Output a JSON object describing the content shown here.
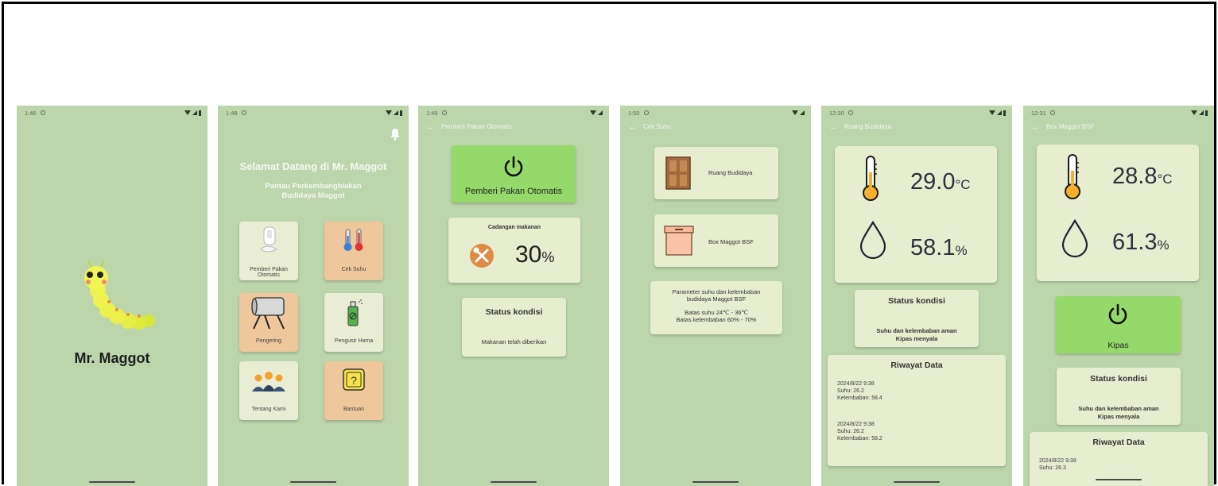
{
  "splash": {
    "time": "1:46",
    "title": "Mr. Maggot"
  },
  "home": {
    "time": "1:48",
    "welcome": "Selamat Datang di Mr. Maggot",
    "subtitle_line1": "Pantau Perkembangbiakan",
    "subtitle_line2": "Budidaya Maggot",
    "tiles": [
      {
        "label_line1": "Pemberi Pakan",
        "label_line2": "Otomatis"
      },
      {
        "label_line1": "Cek Suhu",
        "label_line2": ""
      },
      {
        "label_line1": "Pengering",
        "label_line2": ""
      },
      {
        "label_line1": "Pengusir Hama",
        "label_line2": ""
      },
      {
        "label_line1": "Tentang Kami",
        "label_line2": ""
      },
      {
        "label_line1": "Bantuan",
        "label_line2": ""
      }
    ]
  },
  "feeder": {
    "time": "1:49",
    "title": "Pemberi Pakan Otomatis",
    "button_label": "Pemberi Pakan Otomatis",
    "reserve_label": "Cadangan makanan",
    "reserve_value": "30",
    "reserve_unit": "%",
    "reserve_level": 0.3,
    "status_title": "Status kondisi",
    "status_text": "Makanan telah diberikan"
  },
  "temp_check": {
    "time": "1:50",
    "title": "Cek Suhu",
    "option1": "Ruang Budidaya",
    "option2": "Box Maggot BSF",
    "info_line1": "Parameter suhu dan kelembaban",
    "info_line2": "budidaya Maggot BSF",
    "info_line3": "Batas suhu 24℃ - 36℃",
    "info_line4": "Batas kelembaban 60% - 70%"
  },
  "ruang": {
    "time": "12:30",
    "title": "Ruang Budidaya",
    "temp_value": "29.0",
    "temp_unit": "°C",
    "hum_value": "58.1",
    "hum_unit": "%",
    "status_title": "Status kondisi",
    "status_line1": "Suhu dan kelembaban aman",
    "status_line2": "Kipas menyala",
    "history_title": "Riwayat Data",
    "history": [
      {
        "date": "2024/8/22 9:38",
        "suhu": "Suhu: 26.2",
        "lembab": "Kelembaban: 58.4"
      },
      {
        "date": "2024/8/22 9:38",
        "suhu": "Suhu: 26.2",
        "lembab": "Kelembaban: 58.2"
      }
    ]
  },
  "box": {
    "time": "12:31",
    "title": "Box Maggot BSF",
    "temp_value": "28.8",
    "temp_unit": "°C",
    "hum_value": "61.3",
    "hum_unit": "%",
    "fan_label": "Kipas",
    "status_title": "Status kondisi",
    "status_line1": "Suhu dan kelembaban aman",
    "status_line2": "Kipas menyala",
    "history_title": "Riwayat Data",
    "history_date": "2024/8/22 9:38",
    "history_suhu": "Suhu: 26.3"
  },
  "colors": {
    "phone_bg": "#bcd5ab",
    "card_bg": "#e7edcf",
    "green_button": "#94d96a",
    "tile_orange": "#efc79c"
  }
}
